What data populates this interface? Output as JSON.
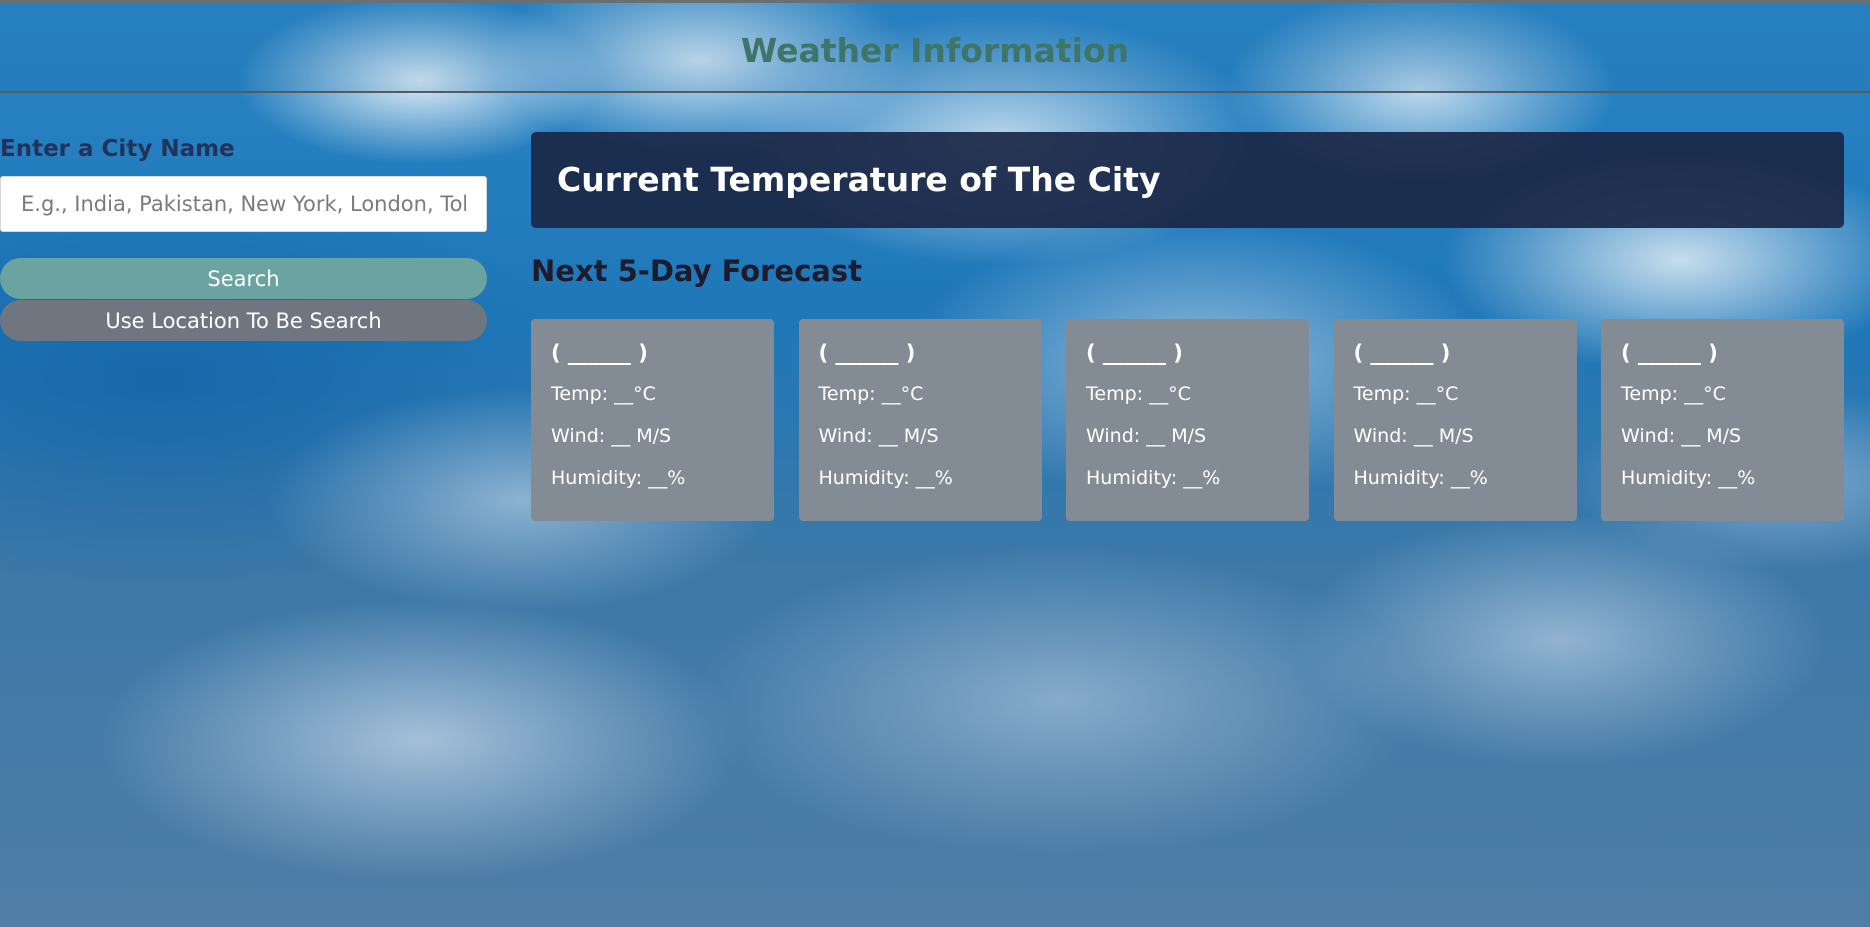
{
  "header": {
    "title": "Weather Information"
  },
  "search": {
    "label": "Enter a City Name",
    "placeholder": "E.g., India, Pakistan, New York, London, Tokyo",
    "value": "",
    "search_button": "Search",
    "location_button": "Use Location To Be Search"
  },
  "current": {
    "title": "Current Temperature of The City"
  },
  "forecast": {
    "title": "Next 5-Day Forecast",
    "cards": [
      {
        "date": "( ______ )",
        "temp": "Temp: __°C",
        "wind": "Wind: __ M/S",
        "humidity": "Humidity: __%"
      },
      {
        "date": "( ______ )",
        "temp": "Temp: __°C",
        "wind": "Wind: __ M/S",
        "humidity": "Humidity: __%"
      },
      {
        "date": "( ______ )",
        "temp": "Temp: __°C",
        "wind": "Wind: __ M/S",
        "humidity": "Humidity: __%"
      },
      {
        "date": "( ______ )",
        "temp": "Temp: __°C",
        "wind": "Wind: __ M/S",
        "humidity": "Humidity: __%"
      },
      {
        "date": "( ______ )",
        "temp": "Temp: __°C",
        "wind": "Wind: __ M/S",
        "humidity": "Humidity: __%"
      }
    ]
  },
  "colors": {
    "title": "#3f7568",
    "label": "#22335a",
    "search_button": "#6ba3a0",
    "location_button": "#6f7680",
    "current_box": "#1b2747",
    "card": "#838c94"
  }
}
